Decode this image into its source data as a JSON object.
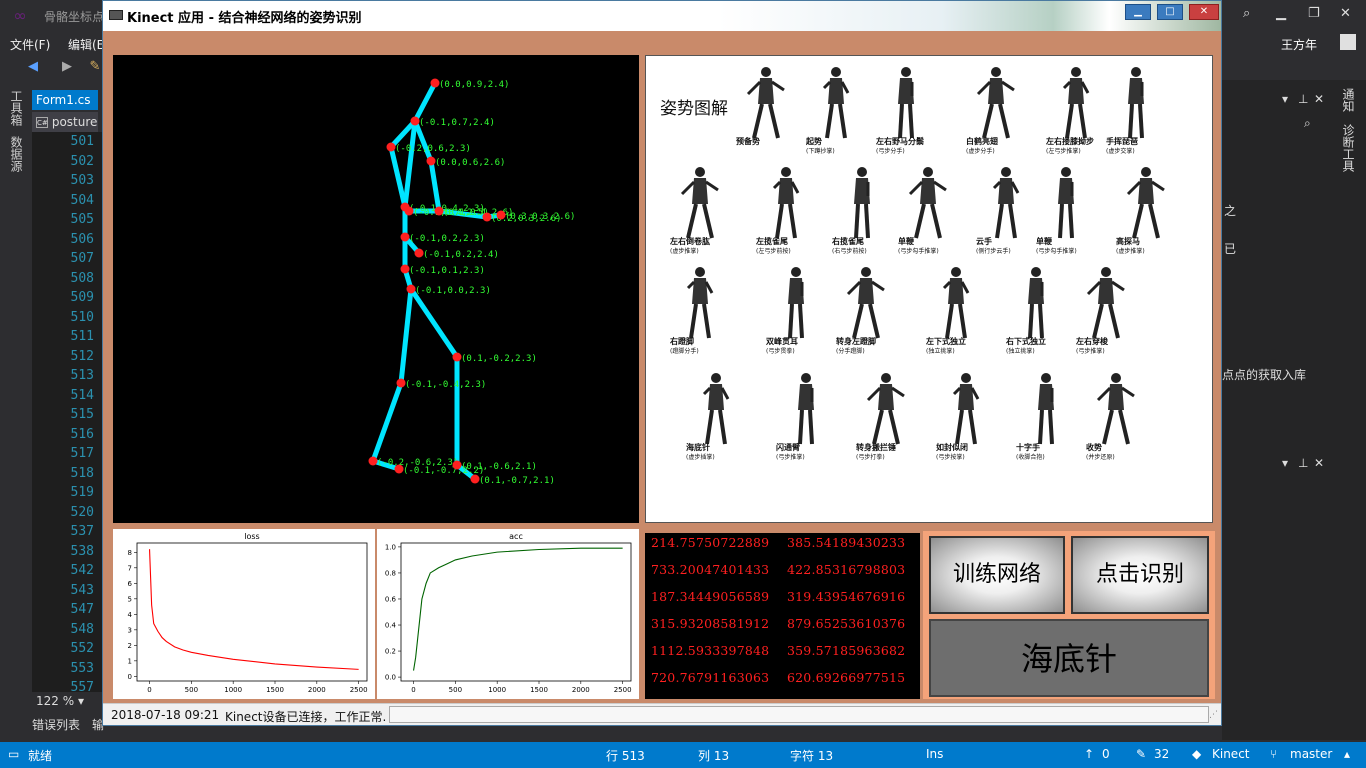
{
  "vs": {
    "title": "骨骼坐标点",
    "menus": [
      "文件(F)",
      "编辑(E"
    ],
    "user": "王方年",
    "left_strip": [
      "工具箱",
      "数据源"
    ],
    "doc_tabs": [
      "Form1.cs",
      "posture"
    ],
    "line_numbers": [
      "501",
      "502",
      "503",
      "504",
      "505",
      "506",
      "507",
      "508",
      "509",
      "510",
      "511",
      "512",
      "513",
      "514",
      "515",
      "516",
      "517",
      "518",
      "519",
      "520",
      "537",
      "538",
      "542",
      "543",
      "547",
      "548",
      "552",
      "553",
      "557"
    ],
    "zoom": "122 %",
    "bottom_tabs": [
      "错误列表",
      "输"
    ],
    "right_vtabs": [
      "通知",
      "诊断工具"
    ],
    "right_snippets": [
      "之",
      "已",
      "点点的获取入库"
    ],
    "status": {
      "ready": "就绪",
      "row": "行 513",
      "col": "列 13",
      "char": "字符 13",
      "ins": "Ins",
      "up": "0",
      "edits": "32",
      "repo": "Kinect",
      "branch": "master"
    }
  },
  "form": {
    "title": "Kinect 应用 - 结合神经网络的姿势识别",
    "controls": [
      "▁",
      "□",
      "✕"
    ],
    "skeleton_labels": [
      "(0.0,0.9,2.4)",
      "(-0.1,0.7,2.4)",
      "(-0.2,0.6,2.3)",
      "(0.0,0.6,2.6)",
      "(-0.1,0.4,2.3)",
      "(-0.1,0.4,2.5)",
      "(0.1,0.4,2.6)",
      "(0.2,0.3,2.6)",
      "(0.3,0.3,2.6)",
      "(-0.1,0.2,2.3)",
      "(-0.1,0.2,2.4)",
      "(-0.1,0.1,2.3)",
      "(-0.1,0.0,2.3)",
      "(0.1,-0.2,2.3)",
      "(-0.1,-0.4,2.3)",
      "(-0.2,-0.6,2.3)",
      "(-0.1,-0.7,2.2)",
      "(0.1,-0.6,2.1)",
      "(0.1,-0.7,2.1)"
    ],
    "diagram": {
      "title": "姿势图解",
      "poses": [
        {
          "name": "预备势",
          "sub": ""
        },
        {
          "name": "起势",
          "sub": "(下蹲抄掌)"
        },
        {
          "name": "左右野马分鬃",
          "sub": "(弓步分手)"
        },
        {
          "name": "白鹤亮翅",
          "sub": "(虚步分手)"
        },
        {
          "name": "左右搂膝拗步",
          "sub": "(左弓步推掌)"
        },
        {
          "name": "手挥琵琶",
          "sub": "(虚步交掌)"
        },
        {
          "name": "左右倒卷肱",
          "sub": "(虚步推掌)"
        },
        {
          "name": "左揽雀尾",
          "sub": "(左弓步前按)"
        },
        {
          "name": "右揽雀尾",
          "sub": "(右弓步前按)"
        },
        {
          "name": "单鞭",
          "sub": "(弓步勾手推掌)"
        },
        {
          "name": "云手",
          "sub": "(侧行步云手)"
        },
        {
          "name": "单鞭",
          "sub": "(弓步勾手推掌)"
        },
        {
          "name": "高探马",
          "sub": "(虚步推掌)"
        },
        {
          "name": "右蹬脚",
          "sub": "(蹬脚分手)"
        },
        {
          "name": "双峰贯耳",
          "sub": "(弓步贯拳)"
        },
        {
          "name": "转身左蹬脚",
          "sub": "(分手蹬脚)"
        },
        {
          "name": "左下式独立",
          "sub": "(独立挑掌)"
        },
        {
          "name": "右下式独立",
          "sub": "(独立挑掌)"
        },
        {
          "name": "左右穿梭",
          "sub": "(弓步推掌)"
        },
        {
          "name": "海底针",
          "sub": "(虚步插掌)"
        },
        {
          "name": "闪通臂",
          "sub": "(弓步推掌)"
        },
        {
          "name": "转身搬拦锤",
          "sub": "(弓步打拳)"
        },
        {
          "name": "如封似闭",
          "sub": "(弓步按掌)"
        },
        {
          "name": "十字手",
          "sub": "(收脚合抱)"
        },
        {
          "name": "收势",
          "sub": "(并步还原)"
        }
      ]
    },
    "numbers": [
      [
        "214.75750722889",
        "385.54189430233"
      ],
      [
        "733.20047401433",
        "422.85316798803"
      ],
      [
        "187.34449056589",
        "319.43954676916"
      ],
      [
        "315.93208581912",
        "879.65253610376"
      ],
      [
        "1112.5933397848",
        "359.57185963682"
      ],
      [
        "720.76791163063",
        "620.69266977515"
      ]
    ],
    "buttons": {
      "train": "训练网络",
      "recognize": "点击识别"
    },
    "result": "海底针",
    "statusbar": {
      "time": "2018-07-18 09:21",
      "message": "Kinect设备已连接，工作正常."
    }
  },
  "chart_data": [
    {
      "type": "line",
      "title": "loss",
      "x": [
        0,
        25,
        50,
        100,
        150,
        200,
        300,
        400,
        500,
        700,
        1000,
        1500,
        2000,
        2500
      ],
      "series": [
        {
          "color": "#ff0000",
          "values": [
            8.2,
            4.6,
            3.4,
            2.9,
            2.5,
            2.25,
            1.9,
            1.7,
            1.55,
            1.35,
            1.1,
            0.8,
            0.6,
            0.45
          ]
        }
      ],
      "xlim": [
        -150,
        2600
      ],
      "ylim": [
        -0.3,
        8.6
      ],
      "xticks": [
        0,
        500,
        1000,
        1500,
        2000,
        2500
      ],
      "yticks": [
        0,
        1,
        2,
        3,
        4,
        5,
        6,
        7,
        8
      ]
    },
    {
      "type": "line",
      "title": "acc",
      "x": [
        0,
        25,
        50,
        75,
        100,
        150,
        200,
        300,
        400,
        500,
        700,
        1000,
        1500,
        2000,
        2500
      ],
      "series": [
        {
          "color": "#006400",
          "values": [
            0.05,
            0.15,
            0.3,
            0.45,
            0.6,
            0.72,
            0.8,
            0.84,
            0.87,
            0.9,
            0.93,
            0.96,
            0.98,
            0.99,
            0.99
          ]
        }
      ],
      "xlim": [
        -150,
        2600
      ],
      "ylim": [
        -0.03,
        1.03
      ],
      "xticks": [
        0,
        500,
        1000,
        1500,
        2000,
        2500
      ],
      "yticks": [
        0.0,
        0.2,
        0.4,
        0.6,
        0.8,
        1.0
      ]
    }
  ]
}
